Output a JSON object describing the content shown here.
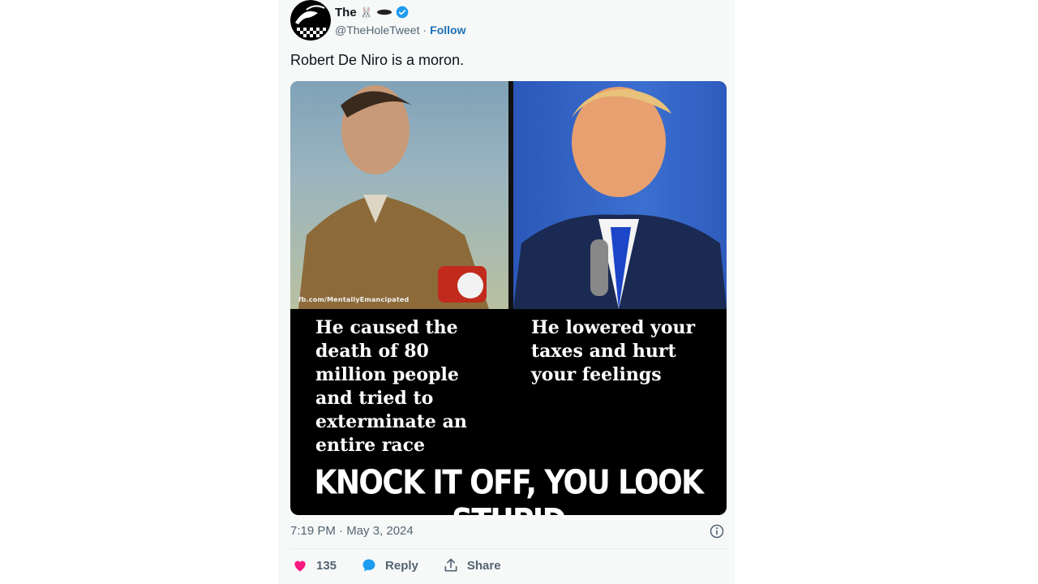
{
  "tweet": {
    "display_name": "The",
    "name_emoji": "🐰",
    "handle": "@TheHoleTweet",
    "separator": "·",
    "follow_label": "Follow",
    "text": "Robert De Niro is a moron.",
    "timestamp": "7:19 PM · May 3, 2024"
  },
  "media": {
    "watermark": "fb.com/MentallyEmancipated",
    "left_caption": "He caused the\ndeath of 80\nmillion people\nand tried to\nexterminate an\nentire race",
    "right_caption": "He lowered your\ntaxes and hurt\nyour feelings",
    "banner": "KNOCK IT OFF, YOU LOOK STUPID"
  },
  "actions": {
    "like_count": "135",
    "reply_label": "Reply",
    "share_label": "Share"
  },
  "colors": {
    "verified": "#1d9bf0",
    "heart": "#f91880",
    "reply": "#1d9bf0",
    "follow": "#1d70b8"
  },
  "icons": [
    "verified-badge-icon",
    "heart-icon",
    "reply-bubble-icon",
    "share-icon",
    "info-icon",
    "hole-tweet-avatar"
  ]
}
